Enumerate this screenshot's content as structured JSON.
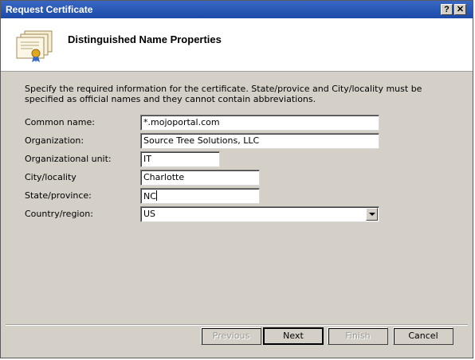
{
  "window": {
    "title": "Request Certificate",
    "help_button": "?",
    "close_button": "✕"
  },
  "header": {
    "title": "Distinguished Name Properties",
    "icon": "certificate-icon"
  },
  "instructions": "Specify the required information for the certificate. State/provice and City/locality must be specified as official names and they cannot contain abbreviations.",
  "form": {
    "common_name": {
      "label": "Common name:",
      "value": "*.mojoportal.com"
    },
    "organization": {
      "label": "Organization:",
      "value": "Source Tree Solutions, LLC"
    },
    "organizational_unit": {
      "label": "Organizational unit:",
      "value": "IT"
    },
    "city": {
      "label": "City/locality",
      "value": "Charlotte"
    },
    "state": {
      "label": "State/province:",
      "value": "NC"
    },
    "country": {
      "label": "Country/region:",
      "value": "US"
    }
  },
  "buttons": {
    "previous": "Previous",
    "next": "Next",
    "finish": "Finish",
    "cancel": "Cancel"
  },
  "colors": {
    "title_bar": "#1b4aa8",
    "dialog_background": "#d4d0c8"
  }
}
